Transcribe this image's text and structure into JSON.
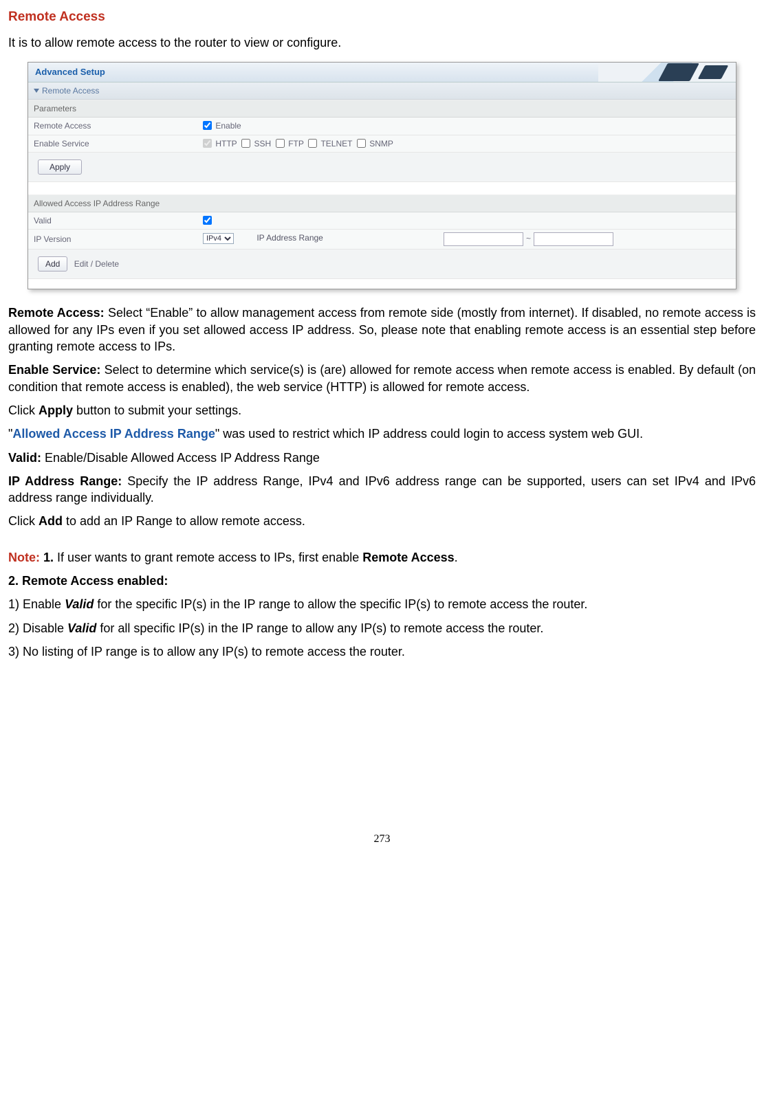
{
  "title": "Remote Access",
  "intro": "It is to allow remote access to the router to view or configure.",
  "shot": {
    "advanced": "Advanced Setup",
    "remoteAccessHdr": "Remote Access",
    "parametersHdr": "Parameters",
    "row_remoteAccess": "Remote Access",
    "enableLabel": "Enable",
    "row_enableService": "Enable Service",
    "svc_http": "HTTP",
    "svc_ssh": "SSH",
    "svc_ftp": "FTP",
    "svc_telnet": "TELNET",
    "svc_snmp": "SNMP",
    "applyBtn": "Apply",
    "allowedHdr": "Allowed Access IP Address Range",
    "row_valid": "Valid",
    "row_ipversion": "IP Version",
    "ipv4": "IPv4",
    "ipRangeLabel": "IP Address Range",
    "addBtn": "Add",
    "editBtn": "Edit / Delete"
  },
  "p_remoteAccess_label": "Remote Access:",
  "p_remoteAccess_text": " Select “Enable” to allow management access from remote side (mostly from internet). If disabled, no remote access is allowed for any IPs even if you set allowed access IP address. So, please note that enabling remote access is an essential step before granting remote access to IPs.",
  "p_enableService_label": "Enable Service:",
  "p_enableService_text": " Select to determine which service(s) is (are) allowed for remote access when remote access is enabled. By default (on condition that remote access is enabled), the web service (HTTP) is allowed for remote access.",
  "p_apply_pre": "Click ",
  "p_apply_b": "Apply",
  "p_apply_post": " button to submit your settings.",
  "p_allowed_pre": "\"",
  "p_allowed_blue": "Allowed Access IP Address Range",
  "p_allowed_post": "\" was used to restrict which IP address could login to access system web GUI.",
  "p_valid_label": "Valid:",
  "p_valid_text": " Enable/Disable Allowed Access IP Address Range",
  "p_iprange_label": "IP Address Range:",
  "p_iprange_text": " Specify the IP address Range, IPv4 and IPv6 address range can be supported, users can set IPv4 and IPv6 address range individually.",
  "p_add_pre": "Click ",
  "p_add_b": "Add",
  "p_add_post": " to add an IP Range to allow remote access.",
  "note_label": "Note:",
  "note1_pre": " 1.",
  "note1_mid": " If user wants to grant remote access to IPs, first enable ",
  "note1_b": "Remote Access",
  "note1_post": ".",
  "note2_head": "2. Remote Access enabled:",
  "note2_1a": "1) Enable ",
  "note2_1b": "Valid",
  "note2_1c": " for the specific IP(s) in the IP range to allow the specific IP(s) to remote access the router.",
  "note2_2a": "2) Disable ",
  "note2_2b": "Valid",
  "note2_2c": " for all specific IP(s) in the IP range to allow any IP(s) to remote access the router.",
  "note2_3": "3) No listing of IP range is to allow any IP(s) to remote access the router.",
  "pageNumber": "273"
}
